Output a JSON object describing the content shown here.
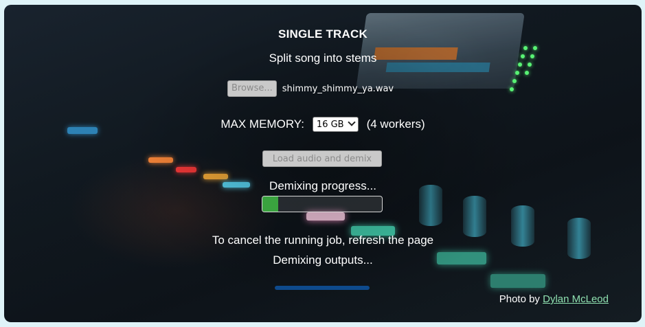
{
  "header": {
    "title": "SINGLE TRACK",
    "subtitle": "Split song into stems"
  },
  "file_input": {
    "browse_label": "Browse...",
    "file_name": "shimmy_shimmy_ya.wav"
  },
  "memory": {
    "label": "MAX MEMORY:",
    "selected": "16 GB",
    "workers_text": "(4 workers)"
  },
  "actions": {
    "load_label": "Load audio and demix"
  },
  "progress": {
    "label": "Demixing progress...",
    "fraction": 0.13,
    "fill_color": "#3aa33f"
  },
  "status": {
    "cancel_note": "To cancel the running job, refresh the page",
    "outputs_label": "Demixing outputs..."
  },
  "credit": {
    "prefix": "Photo by",
    "author": "Dylan McLeod"
  },
  "colors": {
    "page_background": "#dff3f8",
    "link": "#8fe0b0",
    "output_bar": "#0e4a8c"
  }
}
